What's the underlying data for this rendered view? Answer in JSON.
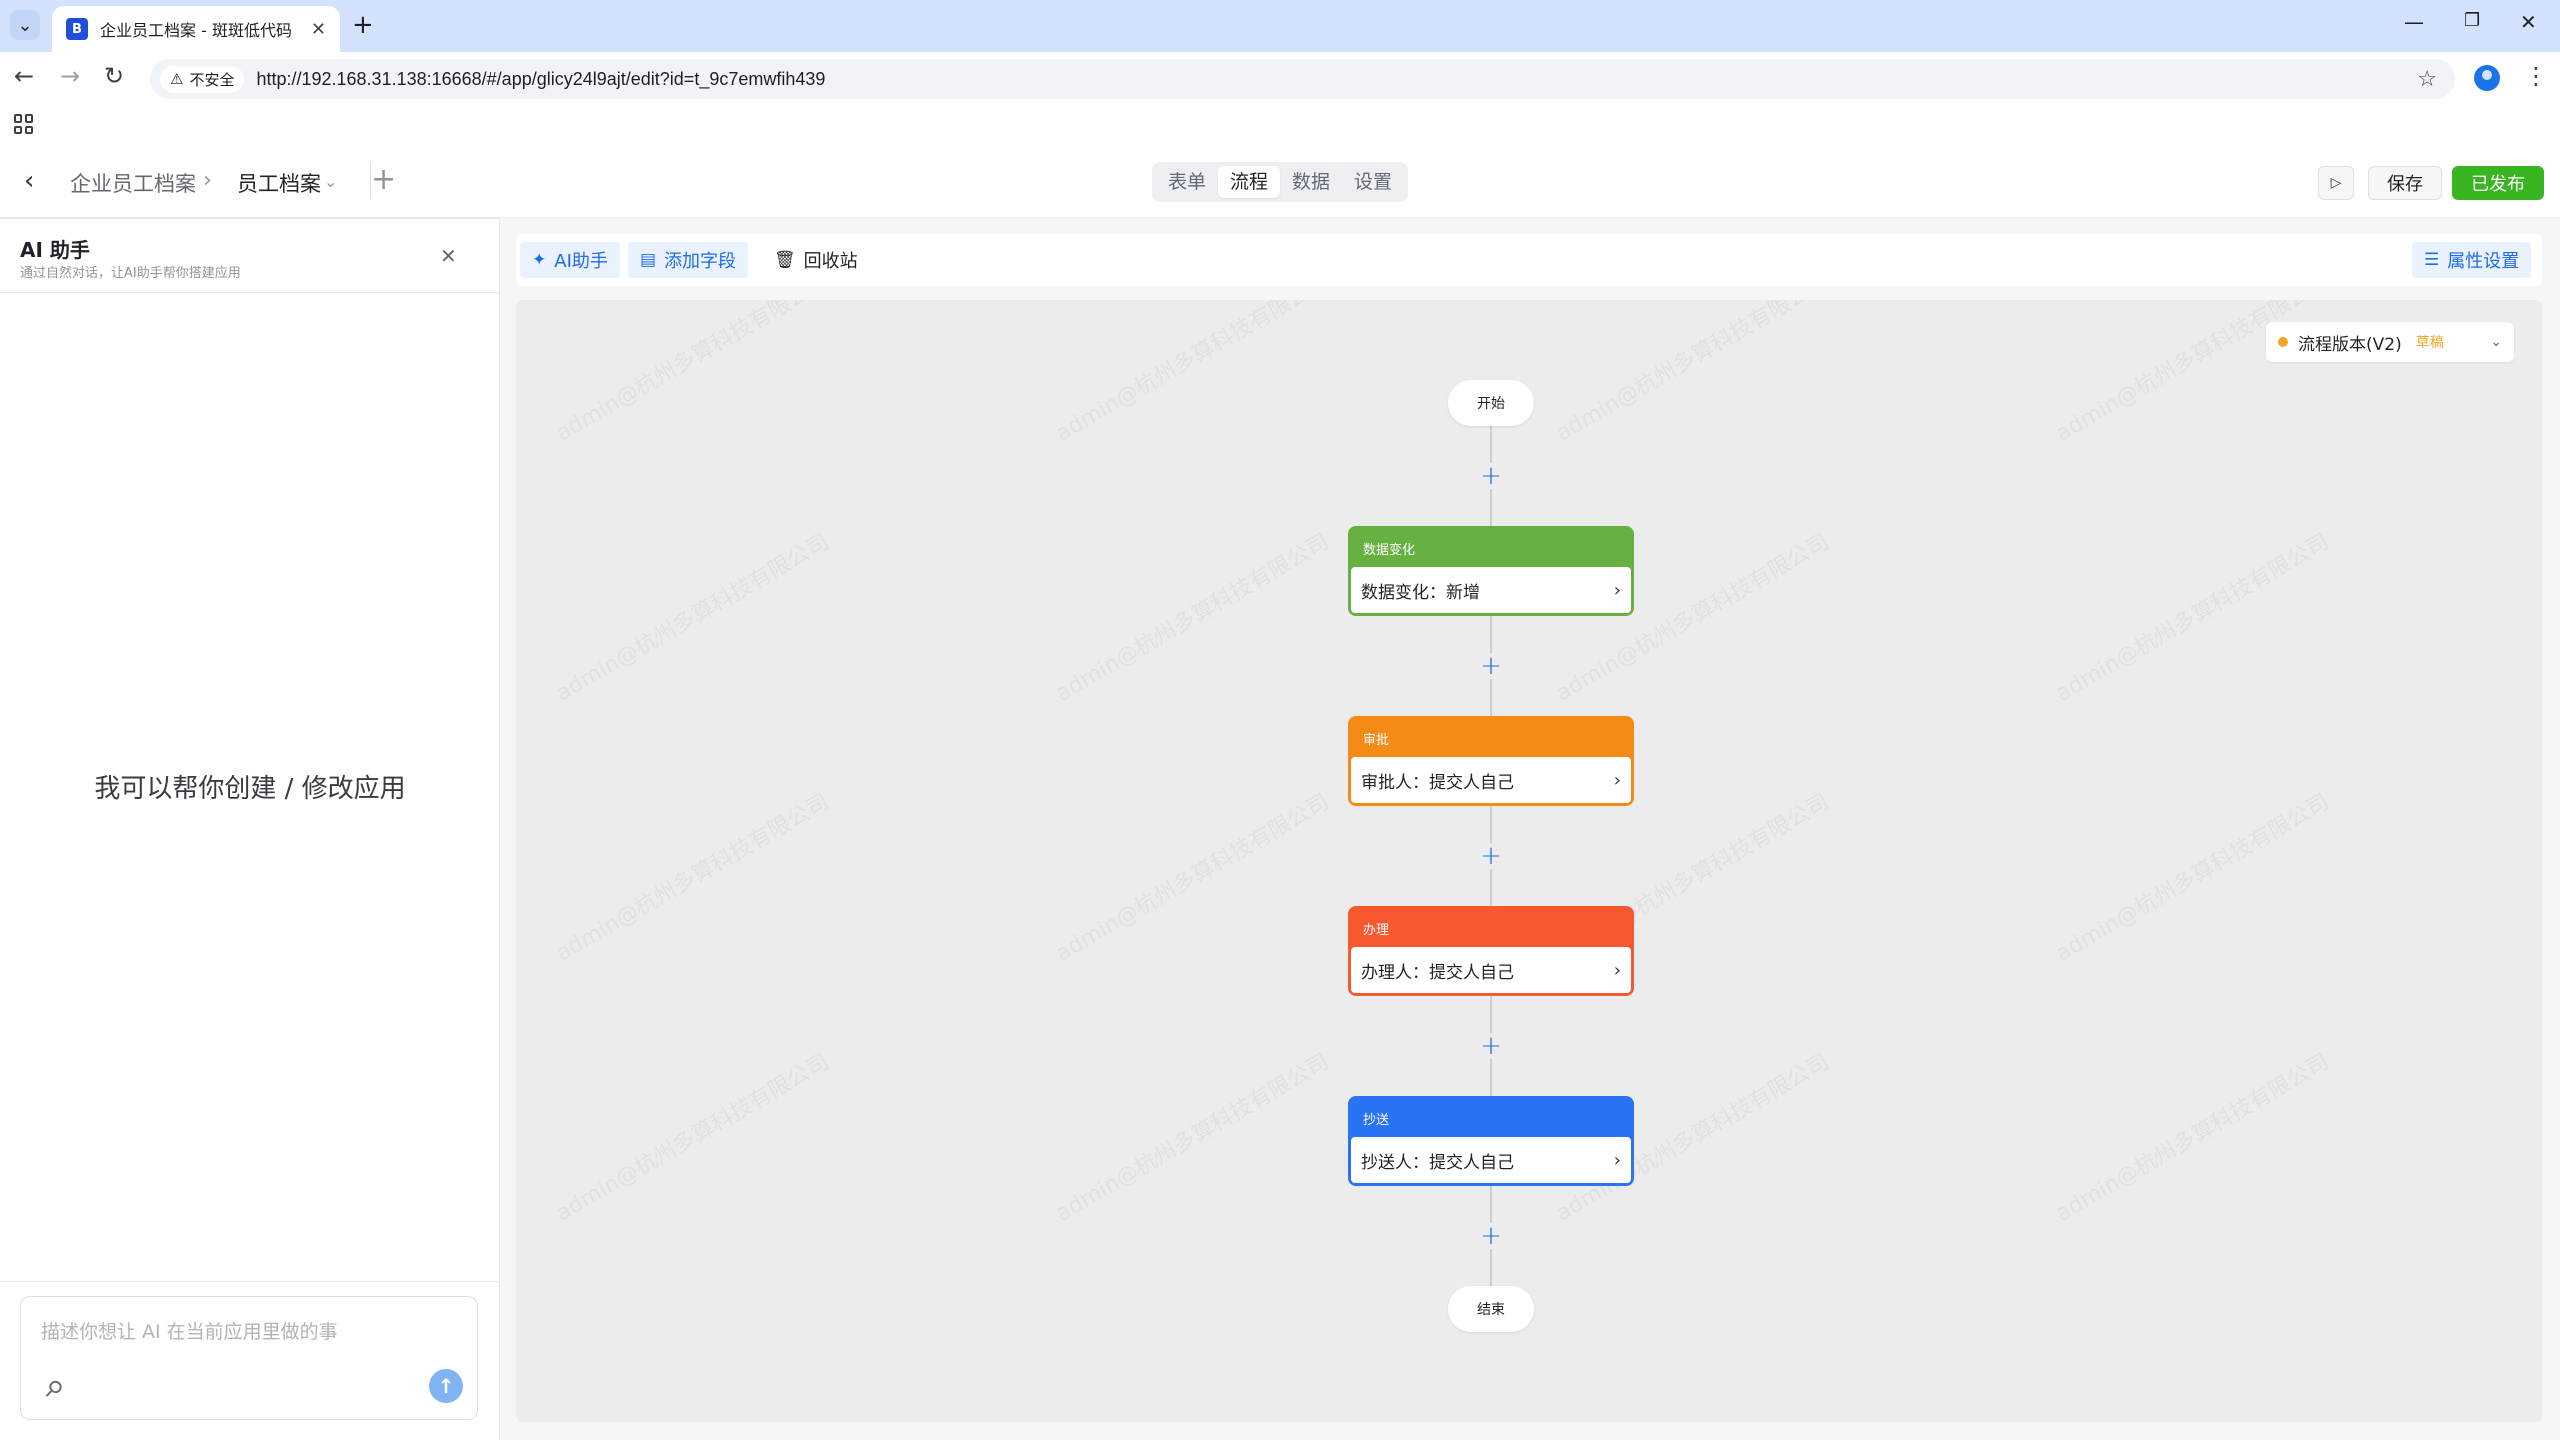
{
  "browser": {
    "tab_title": "企业员工档案 - 斑斑低代码",
    "insecure_label": "不安全",
    "url": "http://192.168.31.138:16668/#/app/glicy24l9ajt/edit?id=t_9c7emwfih439"
  },
  "header": {
    "breadcrumb_root": "企业员工档案",
    "breadcrumb_current": "员工档案",
    "tabs": [
      {
        "label": "表单"
      },
      {
        "label": "流程"
      },
      {
        "label": "数据"
      },
      {
        "label": "设置"
      }
    ],
    "active_tab": "流程",
    "save_label": "保存",
    "publish_label": "已发布"
  },
  "ai_panel": {
    "title": "AI 助手",
    "subtitle": "通过自然对话，让AI助手帮你搭建应用",
    "empty_text": "我可以帮你创建 / 修改应用",
    "input_placeholder": "描述你想让 AI 在当前应用里做的事"
  },
  "toolbar": {
    "ai_label": "AI助手",
    "add_field_label": "添加字段",
    "recycle_label": "回收站",
    "property_label": "属性设置"
  },
  "version": {
    "label": "流程版本(V2)",
    "status": "草稿"
  },
  "watermark": "admin@杭州多算科技有限公司",
  "flow": {
    "start_label": "开始",
    "end_label": "结束",
    "nodes": [
      {
        "title": "数据变化",
        "detail": "数据变化：新增",
        "color": "#67b142"
      },
      {
        "title": "审批",
        "detail": "审批人：提交人自己",
        "color": "#f58b17"
      },
      {
        "title": "办理",
        "detail": "办理人：提交人自己",
        "color": "#f6582f"
      },
      {
        "title": "抄送",
        "detail": "抄送人：提交人自己",
        "color": "#2a73f5"
      }
    ]
  },
  "colors": {
    "accent": "#1f6de6",
    "publish": "#38b520"
  }
}
